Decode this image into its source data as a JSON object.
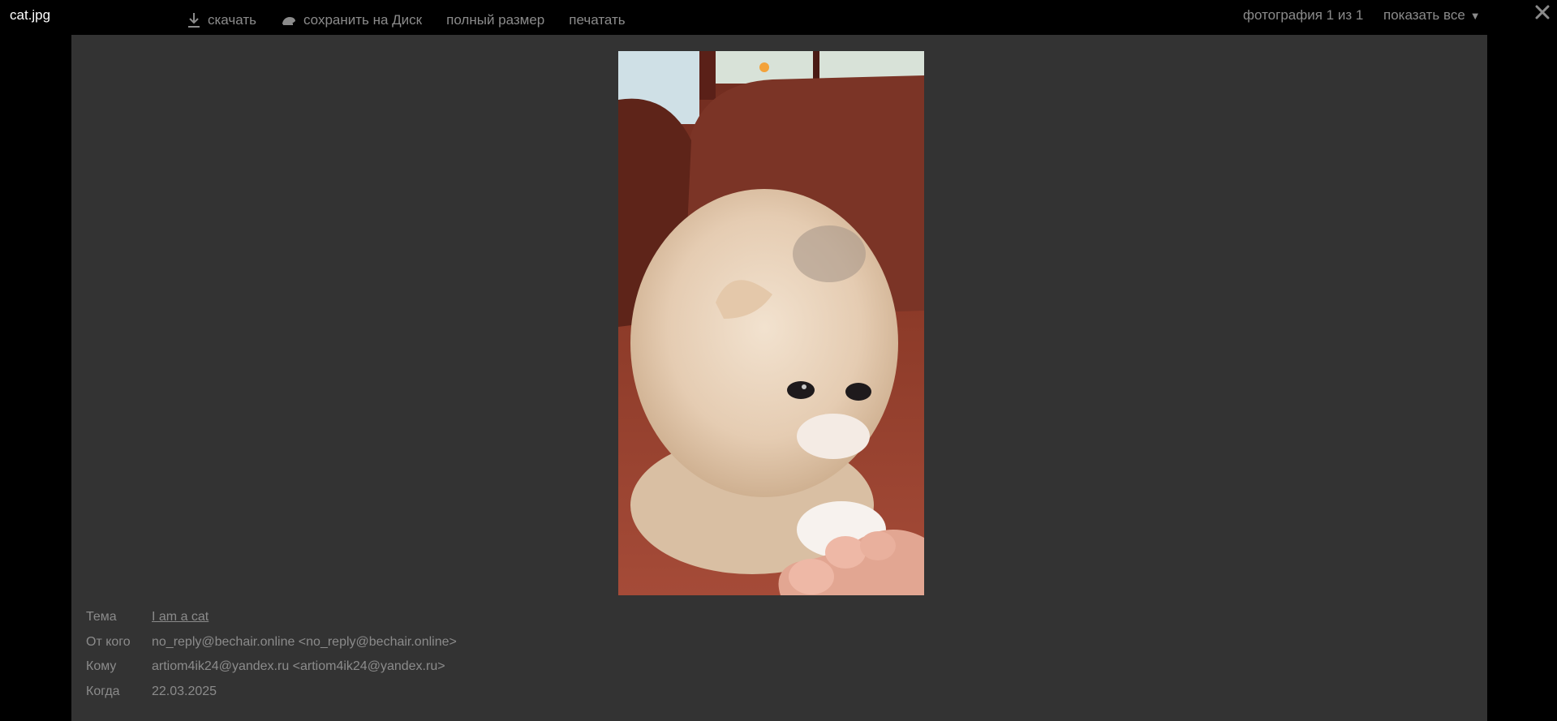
{
  "header": {
    "filename": "cat.jpg",
    "toolbar": [
      {
        "label": "скачать",
        "icon": "download-icon"
      },
      {
        "label": "сохранить на Диск",
        "icon": "disk-icon"
      },
      {
        "label": "полный размер"
      },
      {
        "label": "печатать"
      }
    ],
    "counter": "фотография 1 из 1",
    "show_all": "показать все",
    "show_all_caret": "▼",
    "close_icon": "close-icon"
  },
  "photo": {
    "subject": "kitten",
    "colors": {
      "background": "#8a3a28",
      "fur": "#e9d2bb"
    }
  },
  "meta": [
    {
      "label": "Тема",
      "value": "I am a cat",
      "link": true
    },
    {
      "label": "От кого",
      "value": "no_reply@bechair.online <no_reply@bechair.online>",
      "link": false
    },
    {
      "label": "Кому",
      "value": "artiom4ik24@yandex.ru <artiom4ik24@yandex.ru>",
      "link": false
    },
    {
      "label": "Когда",
      "value": "22.03.2025",
      "link": false
    }
  ],
  "colors": {
    "panel": "#333333",
    "text_muted": "#8b8b8b",
    "page_bg": "#000000"
  }
}
